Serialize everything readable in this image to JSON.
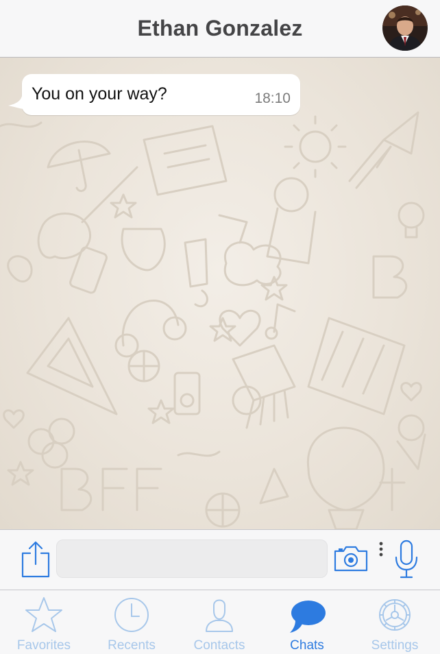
{
  "header": {
    "title": "Ethan Gonzalez"
  },
  "messages": [
    {
      "text": "You on your way?",
      "time": "18:10",
      "direction": "incoming"
    }
  ],
  "composer": {
    "value": "",
    "placeholder": ""
  },
  "tabs": [
    {
      "label": "Favorites",
      "icon": "star-icon",
      "active": false
    },
    {
      "label": "Recents",
      "icon": "clock-icon",
      "active": false
    },
    {
      "label": "Contacts",
      "icon": "person-icon",
      "active": false
    },
    {
      "label": "Chats",
      "icon": "chat-bubble-icon",
      "active": true
    },
    {
      "label": "Settings",
      "icon": "gear-icon",
      "active": false
    }
  ],
  "colors": {
    "accent": "#2d7be0",
    "inactive_tab": "#a7c7ea",
    "bar_background": "#f7f7f8",
    "wallpaper": "#ebe4da"
  }
}
